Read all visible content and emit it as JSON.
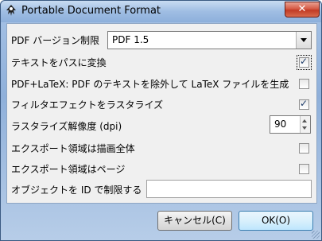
{
  "window": {
    "title": "Portable Document Format",
    "close_symbol": "✕"
  },
  "colors": {
    "titlebar": "#9fbde3",
    "close": "#c13b25",
    "panel": "#f0f0f0"
  },
  "form": {
    "version": {
      "label": "PDF バージョン制限",
      "value": "PDF 1.5"
    },
    "text_to_path": {
      "label": "テキストをパスに変換",
      "checked": true
    },
    "pdf_latex": {
      "label": "PDF+LaTeX: PDF のテキストを除外して LaTeX ファイルを生成",
      "checked": false
    },
    "rasterize_filters": {
      "label": "フィルタエフェクトをラスタライズ",
      "checked": true
    },
    "dpi": {
      "label": "ラスタライズ解像度 (dpi)",
      "value": "90"
    },
    "export_drawing": {
      "label": "エクスポート領域は描画全体",
      "checked": false
    },
    "export_page": {
      "label": "エクスポート領域はページ",
      "checked": false
    },
    "limit_id": {
      "label": "オブジェクトを ID で制限する",
      "value": ""
    }
  },
  "buttons": {
    "cancel": "キャンセル(C)",
    "ok": "OK(O)"
  }
}
